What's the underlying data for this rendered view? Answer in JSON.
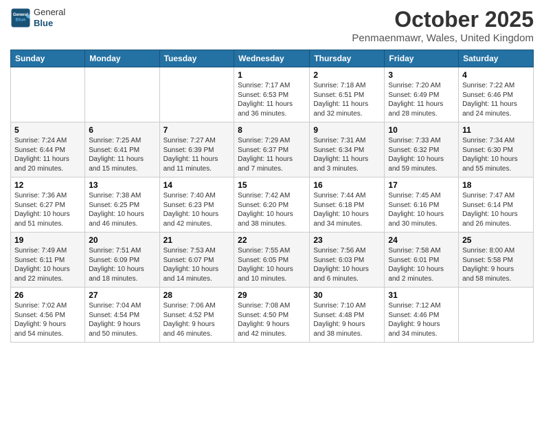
{
  "header": {
    "logo_general": "General",
    "logo_blue": "Blue",
    "month_title": "October 2025",
    "location": "Penmaenmawr, Wales, United Kingdom"
  },
  "weekdays": [
    "Sunday",
    "Monday",
    "Tuesday",
    "Wednesday",
    "Thursday",
    "Friday",
    "Saturday"
  ],
  "weeks": [
    [
      {
        "day": "",
        "info": ""
      },
      {
        "day": "",
        "info": ""
      },
      {
        "day": "",
        "info": ""
      },
      {
        "day": "1",
        "info": "Sunrise: 7:17 AM\nSunset: 6:53 PM\nDaylight: 11 hours\nand 36 minutes."
      },
      {
        "day": "2",
        "info": "Sunrise: 7:18 AM\nSunset: 6:51 PM\nDaylight: 11 hours\nand 32 minutes."
      },
      {
        "day": "3",
        "info": "Sunrise: 7:20 AM\nSunset: 6:49 PM\nDaylight: 11 hours\nand 28 minutes."
      },
      {
        "day": "4",
        "info": "Sunrise: 7:22 AM\nSunset: 6:46 PM\nDaylight: 11 hours\nand 24 minutes."
      }
    ],
    [
      {
        "day": "5",
        "info": "Sunrise: 7:24 AM\nSunset: 6:44 PM\nDaylight: 11 hours\nand 20 minutes."
      },
      {
        "day": "6",
        "info": "Sunrise: 7:25 AM\nSunset: 6:41 PM\nDaylight: 11 hours\nand 15 minutes."
      },
      {
        "day": "7",
        "info": "Sunrise: 7:27 AM\nSunset: 6:39 PM\nDaylight: 11 hours\nand 11 minutes."
      },
      {
        "day": "8",
        "info": "Sunrise: 7:29 AM\nSunset: 6:37 PM\nDaylight: 11 hours\nand 7 minutes."
      },
      {
        "day": "9",
        "info": "Sunrise: 7:31 AM\nSunset: 6:34 PM\nDaylight: 11 hours\nand 3 minutes."
      },
      {
        "day": "10",
        "info": "Sunrise: 7:33 AM\nSunset: 6:32 PM\nDaylight: 10 hours\nand 59 minutes."
      },
      {
        "day": "11",
        "info": "Sunrise: 7:34 AM\nSunset: 6:30 PM\nDaylight: 10 hours\nand 55 minutes."
      }
    ],
    [
      {
        "day": "12",
        "info": "Sunrise: 7:36 AM\nSunset: 6:27 PM\nDaylight: 10 hours\nand 51 minutes."
      },
      {
        "day": "13",
        "info": "Sunrise: 7:38 AM\nSunset: 6:25 PM\nDaylight: 10 hours\nand 46 minutes."
      },
      {
        "day": "14",
        "info": "Sunrise: 7:40 AM\nSunset: 6:23 PM\nDaylight: 10 hours\nand 42 minutes."
      },
      {
        "day": "15",
        "info": "Sunrise: 7:42 AM\nSunset: 6:20 PM\nDaylight: 10 hours\nand 38 minutes."
      },
      {
        "day": "16",
        "info": "Sunrise: 7:44 AM\nSunset: 6:18 PM\nDaylight: 10 hours\nand 34 minutes."
      },
      {
        "day": "17",
        "info": "Sunrise: 7:45 AM\nSunset: 6:16 PM\nDaylight: 10 hours\nand 30 minutes."
      },
      {
        "day": "18",
        "info": "Sunrise: 7:47 AM\nSunset: 6:14 PM\nDaylight: 10 hours\nand 26 minutes."
      }
    ],
    [
      {
        "day": "19",
        "info": "Sunrise: 7:49 AM\nSunset: 6:11 PM\nDaylight: 10 hours\nand 22 minutes."
      },
      {
        "day": "20",
        "info": "Sunrise: 7:51 AM\nSunset: 6:09 PM\nDaylight: 10 hours\nand 18 minutes."
      },
      {
        "day": "21",
        "info": "Sunrise: 7:53 AM\nSunset: 6:07 PM\nDaylight: 10 hours\nand 14 minutes."
      },
      {
        "day": "22",
        "info": "Sunrise: 7:55 AM\nSunset: 6:05 PM\nDaylight: 10 hours\nand 10 minutes."
      },
      {
        "day": "23",
        "info": "Sunrise: 7:56 AM\nSunset: 6:03 PM\nDaylight: 10 hours\nand 6 minutes."
      },
      {
        "day": "24",
        "info": "Sunrise: 7:58 AM\nSunset: 6:01 PM\nDaylight: 10 hours\nand 2 minutes."
      },
      {
        "day": "25",
        "info": "Sunrise: 8:00 AM\nSunset: 5:58 PM\nDaylight: 9 hours\nand 58 minutes."
      }
    ],
    [
      {
        "day": "26",
        "info": "Sunrise: 7:02 AM\nSunset: 4:56 PM\nDaylight: 9 hours\nand 54 minutes."
      },
      {
        "day": "27",
        "info": "Sunrise: 7:04 AM\nSunset: 4:54 PM\nDaylight: 9 hours\nand 50 minutes."
      },
      {
        "day": "28",
        "info": "Sunrise: 7:06 AM\nSunset: 4:52 PM\nDaylight: 9 hours\nand 46 minutes."
      },
      {
        "day": "29",
        "info": "Sunrise: 7:08 AM\nSunset: 4:50 PM\nDaylight: 9 hours\nand 42 minutes."
      },
      {
        "day": "30",
        "info": "Sunrise: 7:10 AM\nSunset: 4:48 PM\nDaylight: 9 hours\nand 38 minutes."
      },
      {
        "day": "31",
        "info": "Sunrise: 7:12 AM\nSunset: 4:46 PM\nDaylight: 9 hours\nand 34 minutes."
      },
      {
        "day": "",
        "info": ""
      }
    ]
  ]
}
